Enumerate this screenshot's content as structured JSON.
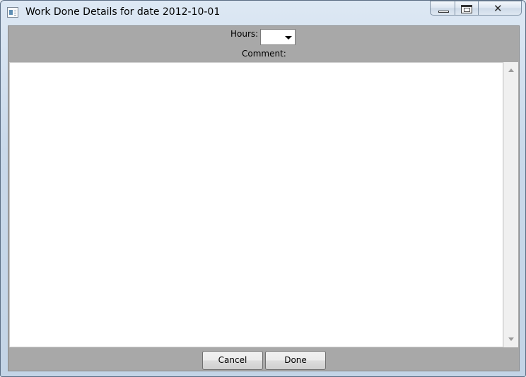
{
  "window": {
    "title": "Work Done Details for date 2012-10-01",
    "controls": {
      "minimize": "minimize-icon",
      "maximize": "maximize-icon",
      "close": "close-icon"
    }
  },
  "form": {
    "hours_label": "Hours:",
    "hours_value": "",
    "comment_label": "Comment:",
    "comment_value": ""
  },
  "buttons": {
    "cancel_label": "Cancel",
    "done_label": "Done"
  },
  "colors": {
    "client_background": "#a8a8a8",
    "titlebar": "#c9d9ea"
  }
}
